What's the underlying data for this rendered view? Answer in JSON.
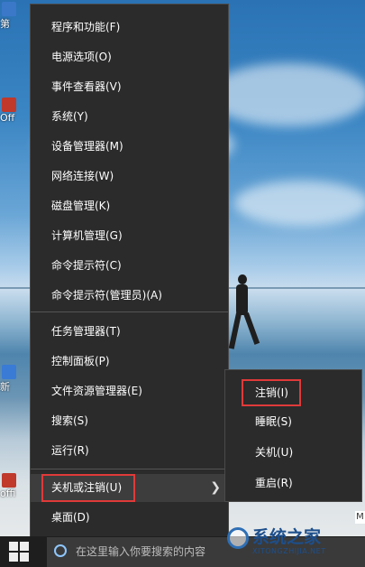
{
  "desktop_icons": [
    {
      "label": "第",
      "color": "#3b78c8"
    },
    {
      "label": "Off",
      "color": "#c0392b"
    },
    {
      "label": "新",
      "color": "#3a7bd5"
    },
    {
      "label": "offi",
      "color": "#c0392b"
    }
  ],
  "menu": {
    "items": [
      {
        "label": "程序和功能(F)"
      },
      {
        "label": "电源选项(O)"
      },
      {
        "label": "事件查看器(V)"
      },
      {
        "label": "系统(Y)"
      },
      {
        "label": "设备管理器(M)"
      },
      {
        "label": "网络连接(W)"
      },
      {
        "label": "磁盘管理(K)"
      },
      {
        "label": "计算机管理(G)"
      },
      {
        "label": "命令提示符(C)"
      },
      {
        "label": "命令提示符(管理员)(A)"
      },
      {
        "label": "任务管理器(T)"
      },
      {
        "label": "控制面板(P)"
      },
      {
        "label": "文件资源管理器(E)"
      },
      {
        "label": "搜索(S)"
      },
      {
        "label": "运行(R)"
      },
      {
        "label": "关机或注销(U)"
      },
      {
        "label": "桌面(D)"
      }
    ],
    "submenu_arrow": "❯"
  },
  "submenu": {
    "items": [
      {
        "label": "注销(I)"
      },
      {
        "label": "睡眠(S)"
      },
      {
        "label": "关机(U)"
      },
      {
        "label": "重启(R)"
      }
    ]
  },
  "taskbar": {
    "search_placeholder": "在这里输入你要搜索的内容"
  },
  "watermark": {
    "title": "系统之家",
    "subtitle": "XITONGZHIJIA.NET",
    "corner": "M"
  },
  "colors": {
    "highlight_box": "#e03a3a",
    "menu_bg": "#2b2b2b",
    "cortana": "#8ec7ff"
  }
}
